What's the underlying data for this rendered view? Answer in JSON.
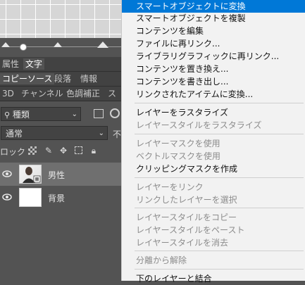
{
  "panel": {
    "tabs_row1": [
      "属性",
      "文字"
    ],
    "tabs_row2": [
      "コピーソース",
      "段落",
      "情報"
    ],
    "tabs_row3": [
      "3D",
      "チャンネル",
      "色調補正",
      "ス"
    ],
    "filter_label": "種類",
    "blend_mode": "通常",
    "opacity_fragment": "不",
    "lock_label": "ロック :",
    "layers": [
      {
        "name": "男性",
        "selected": true
      },
      {
        "name": "背景",
        "selected": false
      }
    ]
  },
  "menu": {
    "groups": [
      [
        {
          "label": "スマートオブジェクトに変換",
          "enabled": true,
          "highlighted": true
        },
        {
          "label": "スマートオブジェクトを複製",
          "enabled": true
        },
        {
          "label": "コンテンツを編集",
          "enabled": true
        },
        {
          "label": "ファイルに再リンク...",
          "enabled": true
        },
        {
          "label": "ライブラリグラフィックに再リンク...",
          "enabled": true
        },
        {
          "label": "コンテンツを置き換え...",
          "enabled": true
        },
        {
          "label": "コンテンツを書き出し...",
          "enabled": true
        },
        {
          "label": "リンクされたアイテムに変換...",
          "enabled": true
        }
      ],
      [
        {
          "label": "レイヤーをラスタライズ",
          "enabled": true
        },
        {
          "label": "レイヤースタイルをラスタライズ",
          "enabled": false
        }
      ],
      [
        {
          "label": "レイヤーマスクを使用",
          "enabled": false
        },
        {
          "label": "ベクトルマスクを使用",
          "enabled": false
        },
        {
          "label": "クリッピングマスクを作成",
          "enabled": true
        }
      ],
      [
        {
          "label": "レイヤーをリンク",
          "enabled": false
        },
        {
          "label": "リンクしたレイヤーを選択",
          "enabled": false
        }
      ],
      [
        {
          "label": "レイヤースタイルをコピー",
          "enabled": false
        },
        {
          "label": "レイヤースタイルをペースト",
          "enabled": false
        },
        {
          "label": "レイヤースタイルを消去",
          "enabled": false
        }
      ],
      [
        {
          "label": "分離から解除",
          "enabled": false
        }
      ],
      [
        {
          "label": "下のレイヤーと結合",
          "enabled": true
        }
      ]
    ]
  },
  "colors": {
    "highlight": "#0078d7",
    "panel_bg": "#535353",
    "menu_bg": "#f2f2f2"
  }
}
